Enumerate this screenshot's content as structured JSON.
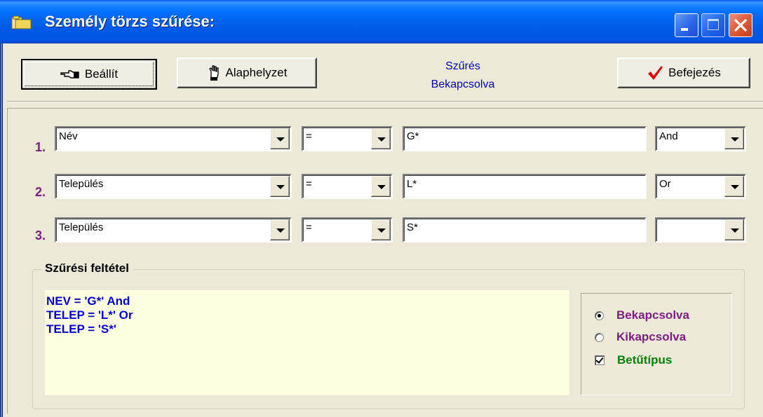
{
  "window": {
    "title": "Személy törzs szűrése:"
  },
  "toolbar": {
    "set_label": "Beállít",
    "reset_label": "Alaphelyzet",
    "finish_label": "Befejezés",
    "status_line1": "Szűrés",
    "status_line2": "Bekapcsolva"
  },
  "rows": [
    {
      "num": "1.",
      "field": "Név",
      "op": "=",
      "value": "G*",
      "logic": "And"
    },
    {
      "num": "2.",
      "field": "Település",
      "op": "=",
      "value": "L*",
      "logic": "Or"
    },
    {
      "num": "3.",
      "field": "Település",
      "op": "=",
      "value": "S*",
      "logic": ""
    }
  ],
  "condition": {
    "title": "Szűrési feltétel",
    "lines": [
      "NEV = 'G*' And",
      "TELEP = 'L*' Or",
      "TELEP = 'S*'"
    ]
  },
  "options": {
    "on_label": "Bekapcsolva",
    "off_label": "Kikapcsolva",
    "font_label": "Betűtípus",
    "selected": "on",
    "font_checked": true
  },
  "colors": {
    "row_number": "#7B1F80",
    "condition_text": "#0000D0",
    "on_option": "#7B1F80",
    "font_option": "#008000",
    "status_text": "#0000B0"
  }
}
